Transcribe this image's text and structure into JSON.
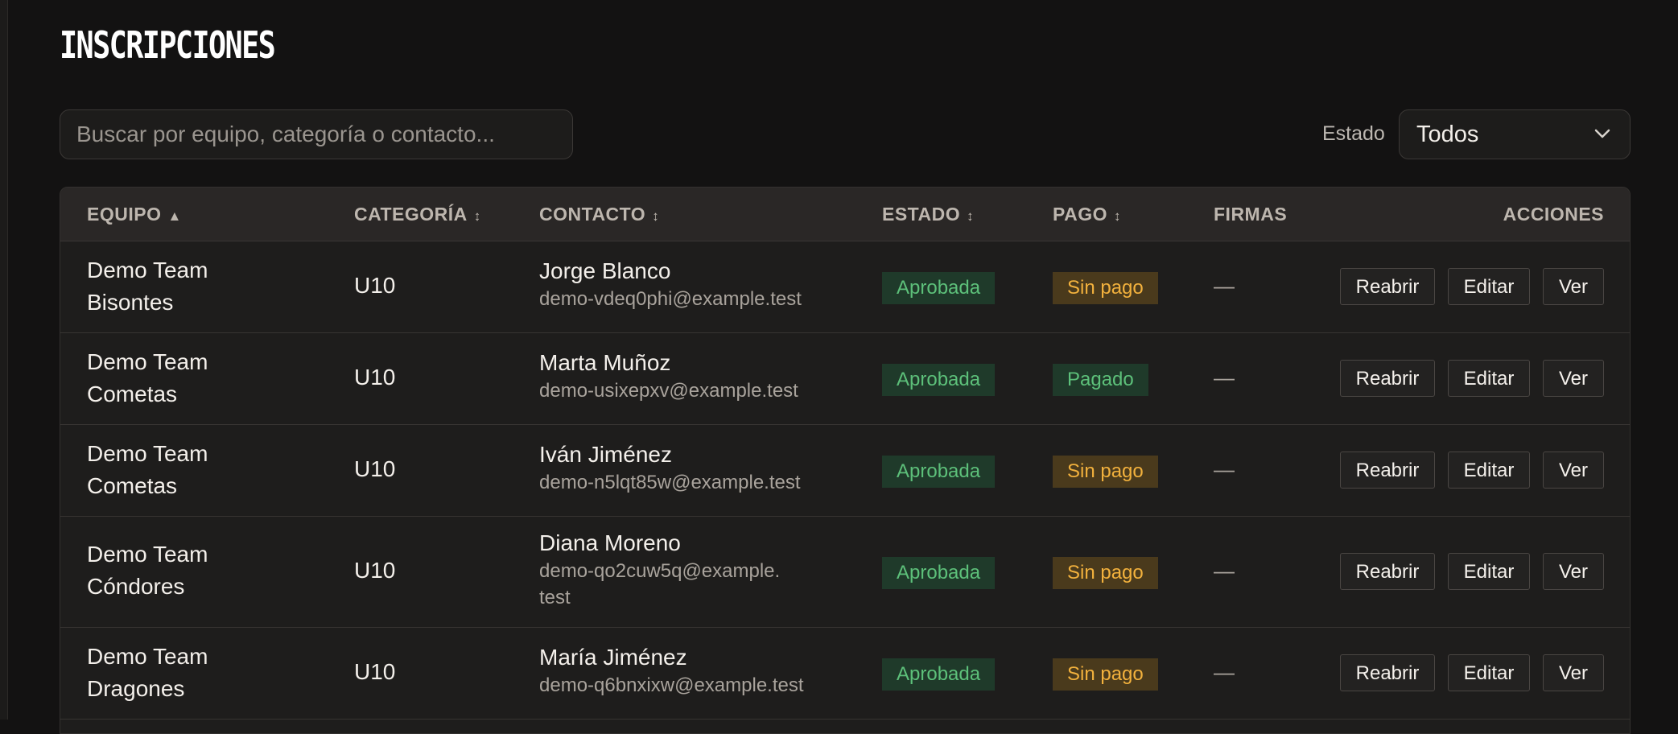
{
  "page": {
    "title": "INSCRIPCIONES"
  },
  "search": {
    "placeholder": "Buscar por equipo, categoría o contacto...",
    "value": ""
  },
  "filter": {
    "label": "Estado",
    "selected": "Todos"
  },
  "table": {
    "headers": {
      "team": "EQUIPO",
      "team_sort": "▲",
      "category": "CATEGORÍA",
      "category_sort": "↕",
      "contact": "CONTACTO",
      "contact_sort": "↕",
      "status": "ESTADO",
      "status_sort": "↕",
      "payment": "PAGO",
      "payment_sort": "↕",
      "signatures": "FIRMAS",
      "actions": "ACCIONES"
    },
    "rows": [
      {
        "team": "Demo Team Bisontes",
        "category": "U10",
        "contact_name": "Jorge Blanco",
        "contact_email": "demo-vdeq0phi@example.test",
        "status": "Aprobada",
        "payment": "Sin pago",
        "signatures": "—",
        "reopen": "Reabrir",
        "edit": "Editar",
        "view": "Ver"
      },
      {
        "team": "Demo Team Cometas",
        "category": "U10",
        "contact_name": "Marta Muñoz",
        "contact_email": "demo-usixepxv@example.test",
        "status": "Aprobada",
        "payment": "Pagado",
        "signatures": "—",
        "reopen": "Reabrir",
        "edit": "Editar",
        "view": "Ver"
      },
      {
        "team": "Demo Team Cometas",
        "category": "U10",
        "contact_name": "Iván Jiménez",
        "contact_email": "demo-n5lqt85w@example.test",
        "status": "Aprobada",
        "payment": "Sin pago",
        "signatures": "—",
        "reopen": "Reabrir",
        "edit": "Editar",
        "view": "Ver"
      },
      {
        "team": "Demo Team Cóndores",
        "category": "U10",
        "contact_name": "Diana Moreno",
        "contact_email": "demo-qo2cuw5q@example.test",
        "status": "Aprobada",
        "payment": "Sin pago",
        "signatures": "—",
        "reopen": "Reabrir",
        "edit": "Editar",
        "view": "Ver"
      },
      {
        "team": "Demo Team Dragones",
        "category": "U10",
        "contact_name": "María Jiménez",
        "contact_email": "demo-q6bnxixw@example.test",
        "status": "Aprobada",
        "payment": "Sin pago",
        "signatures": "—",
        "reopen": "Reabrir",
        "edit": "Editar",
        "view": "Ver"
      }
    ]
  },
  "colors": {
    "background": "#131212",
    "approved_bg": "#1f3a2a",
    "approved_text": "#5dc07a",
    "unpaid_bg": "#4a3a1c",
    "unpaid_text": "#f2b13d",
    "paid_bg": "#1f3a2a",
    "paid_text": "#5dc07a"
  },
  "icons": {
    "select_chevron": "chevron-down-icon"
  }
}
